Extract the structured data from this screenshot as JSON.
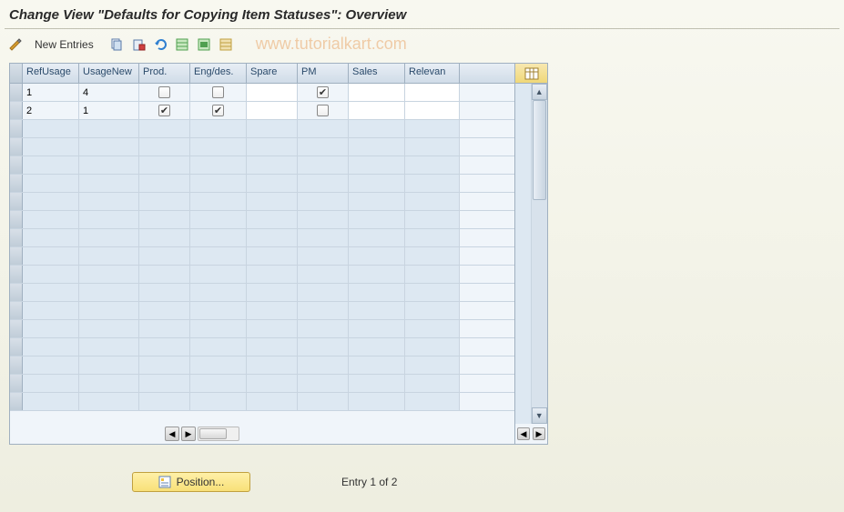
{
  "title": "Change View \"Defaults for Copying Item Statuses\": Overview",
  "toolbar": {
    "new_entries": "New Entries"
  },
  "watermark": "www.tutorialkart.com",
  "columns": {
    "refusage": "RefUsage",
    "usagenew": "UsageNew",
    "prod": "Prod.",
    "engdes": "Eng/des.",
    "spare": "Spare",
    "pm": "PM",
    "sales": "Sales",
    "relevan": "Relevan"
  },
  "rows": [
    {
      "refusage": "1",
      "usagenew": "4",
      "prod": false,
      "engdes": false,
      "spare": "",
      "pm": true,
      "sales": "",
      "relevan": ""
    },
    {
      "refusage": "2",
      "usagenew": "1",
      "prod": true,
      "engdes": true,
      "spare": "",
      "pm": false,
      "sales": "",
      "relevan": ""
    }
  ],
  "footer": {
    "position_label": "Position...",
    "entry_text": "Entry 1 of 2"
  }
}
